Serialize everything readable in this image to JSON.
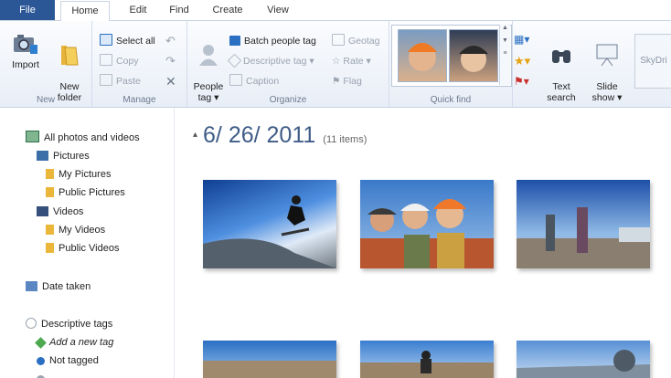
{
  "tabs": [
    "File",
    "Home",
    "Edit",
    "Find",
    "Create",
    "View"
  ],
  "ribbon": {
    "new": {
      "group_label": "New",
      "import_label": "Import",
      "new_folder_label": "New\nfolder"
    },
    "manage": {
      "group_label": "Manage",
      "select_all": "Select all",
      "copy": "Copy",
      "paste": "Paste"
    },
    "organize": {
      "group_label": "Organize",
      "people_tag": "People\ntag ▾",
      "batch_people_tag": "Batch people tag",
      "geotag": "Geotag",
      "descriptive_tag": "Descriptive tag ▾",
      "rate": "Rate ▾",
      "caption": "Caption",
      "flag": "Flag"
    },
    "quick_find": {
      "group_label": "Quick find"
    },
    "text_search": "Text\nsearch",
    "slide_show": "Slide\nshow ▾",
    "skydrive": "SkyDri"
  },
  "sidebar": {
    "all_photos": "All photos and videos",
    "pictures": "Pictures",
    "my_pictures": "My Pictures",
    "public_pictures": "Public Pictures",
    "videos": "Videos",
    "my_videos": "My Videos",
    "public_videos": "Public Videos",
    "date_taken": "Date taken",
    "descriptive_tags": "Descriptive tags",
    "add_tag": "Add a new tag",
    "not_tagged": "Not tagged"
  },
  "content": {
    "collapse_glyph": "▴",
    "date_heading": "6/ 26/ 2011",
    "item_count": "(11 items)"
  },
  "colors": {
    "file_tab": "#2b5797",
    "heading": "#3f5c87",
    "accent": "#2b6fc2"
  }
}
